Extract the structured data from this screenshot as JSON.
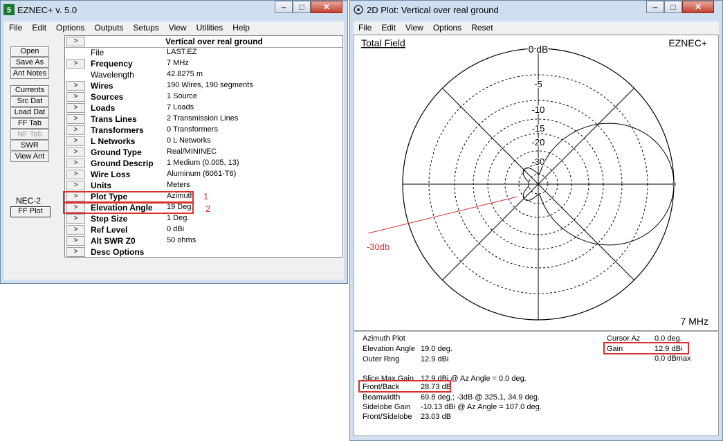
{
  "main_window": {
    "title": "EZNEC+  v. 5.0",
    "menu": [
      "File",
      "Edit",
      "Options",
      "Outputs",
      "Setups",
      "View",
      "Utilities",
      "Help"
    ],
    "buttons": [
      "Open",
      "Save As",
      "Ant Notes",
      "Currents",
      "Src Dat",
      "Load Dat",
      "FF Tab",
      "NF Tab",
      "SWR",
      "View Ant"
    ],
    "disabled_button": "NF Tab",
    "engine_label": "NEC-2",
    "ff_plot_button": "FF Plot",
    "grid_header": {
      "arrow": ">",
      "title": "Vertical over real ground"
    },
    "rows": [
      {
        "label": "File",
        "value": "LAST.EZ",
        "has_button": false
      },
      {
        "label": "Frequency",
        "value": "7 MHz",
        "has_button": true
      },
      {
        "label": "Wavelength",
        "value": "42.8275 m",
        "has_button": false
      },
      {
        "label": "Wires",
        "value": "190 Wires, 190 segments",
        "has_button": true
      },
      {
        "label": "Sources",
        "value": "1 Source",
        "has_button": true
      },
      {
        "label": "Loads",
        "value": "7 Loads",
        "has_button": true
      },
      {
        "label": "Trans Lines",
        "value": "2 Transmission Lines",
        "has_button": true
      },
      {
        "label": "Transformers",
        "value": "0 Transformers",
        "has_button": true
      },
      {
        "label": "L Networks",
        "value": "0 L Networks",
        "has_button": true
      },
      {
        "label": "Ground Type",
        "value": "Real/MININEC",
        "has_button": true
      },
      {
        "label": "Ground Descrip",
        "value": "1 Medium (0.005, 13)",
        "has_button": true
      },
      {
        "label": "Wire Loss",
        "value": "Aluminum (6061-T6)",
        "has_button": true
      },
      {
        "label": "Units",
        "value": "Meters",
        "has_button": true
      },
      {
        "label": "Plot Type",
        "value": "Azimuth",
        "has_button": true
      },
      {
        "label": "Elevation Angle",
        "value": "19 Deg.",
        "has_button": true
      },
      {
        "label": "Step Size",
        "value": "1 Deg.",
        "has_button": true
      },
      {
        "label": "Ref Level",
        "value": "0 dBi",
        "has_button": true
      },
      {
        "label": "Alt SWR Z0",
        "value": "50 ohms",
        "has_button": true
      },
      {
        "label": "Desc Options",
        "value": "",
        "has_button": true
      }
    ],
    "annotations": {
      "plot_type": "1",
      "elevation_angle": "2"
    }
  },
  "plot_window": {
    "title": "2D Plot: Vertical over real ground",
    "menu": [
      "File",
      "Edit",
      "View",
      "Options",
      "Reset"
    ],
    "field_label": "Total Field",
    "brand": "EZNEC+",
    "top_label": "0 dB",
    "ring_labels": [
      "-5",
      "-10",
      "-15",
      "-20",
      "-30"
    ],
    "freq_label": "7 MHz",
    "annotation": "-30db",
    "info_left": [
      {
        "label": "Azimuth Plot",
        "value": ""
      },
      {
        "label": "Elevation Angle",
        "value": "19.0 deg."
      },
      {
        "label": "Outer Ring",
        "value": "12.9 dBi"
      },
      {
        "label": "",
        "value": ""
      },
      {
        "label": "Slice Max Gain",
        "value": "12.9 dBi @ Az Angle = 0.0 deg."
      },
      {
        "label": "Front/Back",
        "value": "28.73 dB"
      },
      {
        "label": "Beamwidth",
        "value": "69.8 deg.; -3dB @ 325.1, 34.9 deg."
      },
      {
        "label": "Sidelobe Gain",
        "value": "-10.13 dBi @ Az Angle = 107.0 deg."
      },
      {
        "label": "Front/Sidelobe",
        "value": "23.03 dB"
      }
    ],
    "info_right": [
      {
        "label": "Cursor Az",
        "value": "0.0 deg."
      },
      {
        "label": "Gain",
        "value": "12.9 dBi"
      },
      {
        "label": "",
        "value": "0.0 dBmax"
      }
    ]
  },
  "colors": {
    "annotation_red": "#d93030",
    "pattern": "#000000"
  }
}
